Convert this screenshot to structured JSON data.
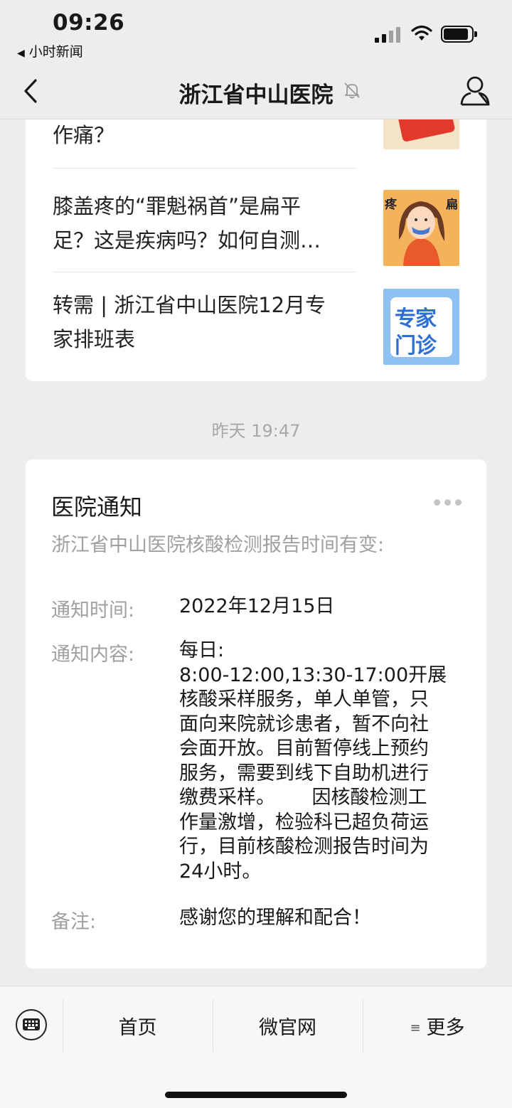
{
  "status_bar": {
    "time": "09:26",
    "back_app": "小时新闻"
  },
  "nav": {
    "title": "浙江省中山医院",
    "icons": [
      "back-icon",
      "mute-bell-icon",
      "profile-icon"
    ]
  },
  "articles": [
    {
      "title_lines": [
        "作痛？"
      ]
    },
    {
      "title_lines": [
        "膝盖疼的“罪魁祸首”是扁平",
        "足？这是疾病吗？如何自测…"
      ],
      "thumb_text_left": "疼",
      "thumb_text_right": "扁"
    },
    {
      "title_lines": [
        "转需 | 浙江省中山医院12月专",
        "家排班表"
      ],
      "thumb_text": [
        "专家",
        "门诊"
      ]
    }
  ],
  "timestamp": "昨天 19:47",
  "notice": {
    "title": "医院通知",
    "subtitle": "浙江省中山医院核酸检测报告时间有变:",
    "fields": [
      {
        "label": "通知时间:",
        "value_lines": [
          "2022年12月15日"
        ]
      },
      {
        "label": "通知内容:",
        "value_lines": [
          "每日:",
          "8:00-12:00,13:30-17:00开展",
          "核酸采样服务，单人单管，只",
          "面向来院就诊患者，暂不向社",
          "会面开放。目前暂停线上预约",
          "服务，需要到线下自助机进行",
          "缴费采样。      因核酸检测工",
          "作量激增，检验科已超负荷运",
          "行，目前核酸检测报告时间为",
          "24小时。"
        ]
      },
      {
        "label": "备注:",
        "value_lines": [
          "感谢您的理解和配合！"
        ]
      }
    ]
  },
  "bottom_menu": {
    "items": [
      "首页",
      "微官网",
      "更多"
    ],
    "more_icon": "list-icon"
  },
  "colors": {
    "background": "#ededed",
    "card": "#ffffff",
    "muted_text": "#a0a0a0",
    "thumb_red": "#e23a2a",
    "thumb_orange": "#f2a64b",
    "thumb_blue": "#3a86e6"
  }
}
